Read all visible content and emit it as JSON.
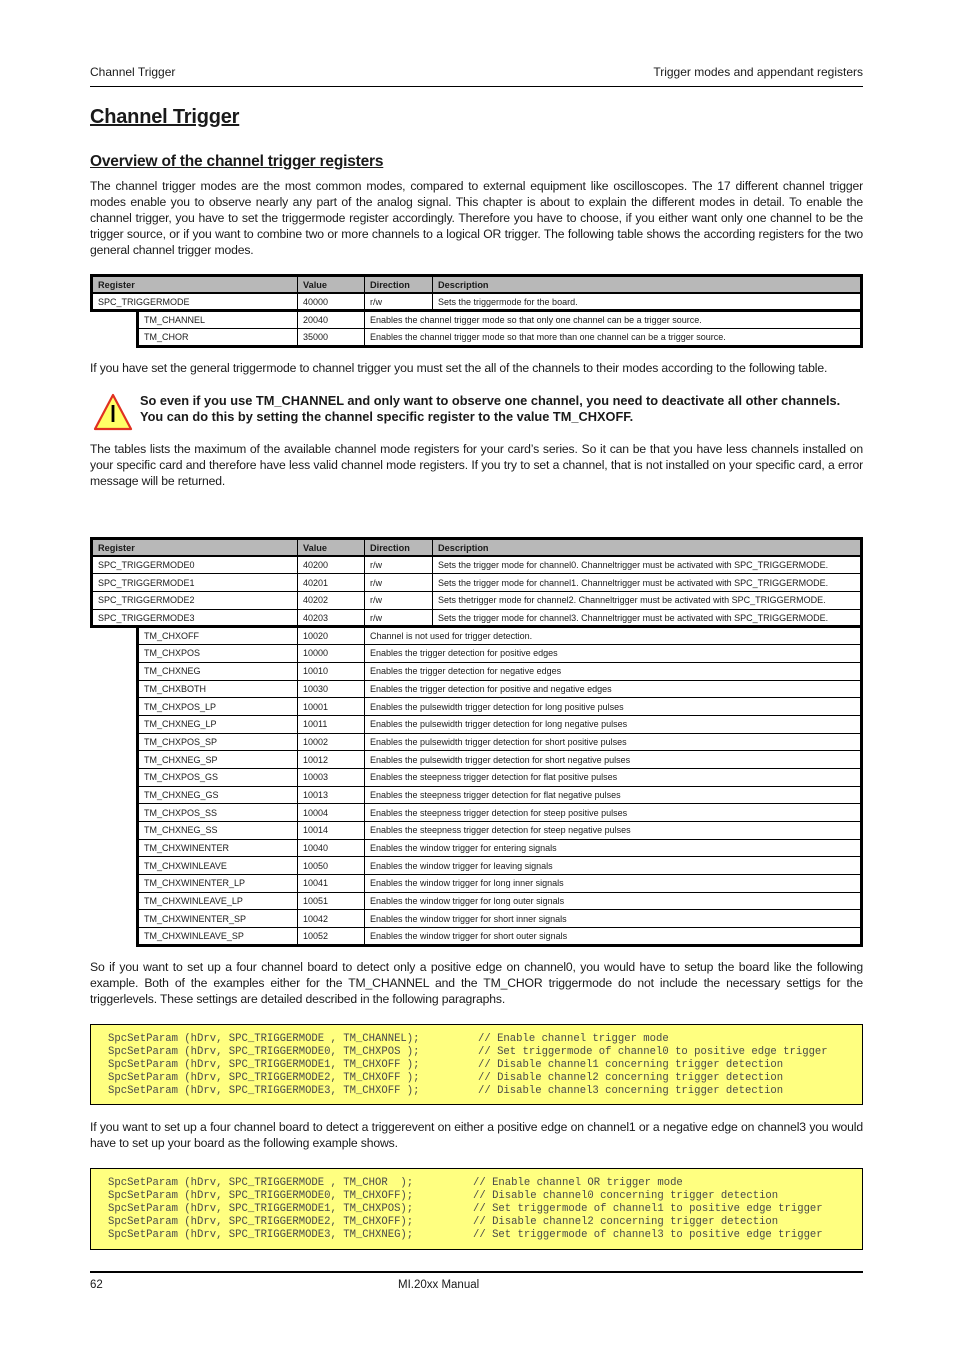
{
  "header": {
    "left": "Channel Trigger",
    "right": "Trigger modes and appendant registers"
  },
  "title": "Channel Trigger",
  "section_title": "Overview of the channel trigger registers",
  "paragraphs": {
    "intro": "The channel trigger modes are the most common modes, compared to external equipment like oscilloscopes. The 17 different channel trigger modes enable you to observe nearly any part of the analog signal. This chapter is about to explain the different modes in detail. To enable the channel trigger, you have to set the triggermode register accordingly. Therefore you have to choose, if you either want only one channel to be the trigger source, or if you want to combine two or more channels to a logical OR trigger. The following table shows the according registers for the two general channel trigger modes.",
    "set_channels": "If you have set the general triggermode to channel trigger you must set the all of the channels to their modes according to the following table.",
    "max_registers": "The tables lists the maximum of the available channel mode registers for your card’s series. So it can be that you have less channels installed on your specific card and therefore have less valid channel mode registers. If you try to set a channel, that is not installed on your specific card, a error message will be returned.",
    "example1_intro": "So if you want to set up a four channel board to detect only a positive edge on channel0, you would have to setup the board like the following example. Both of the examples either for the TM_CHANNEL and the TM_CHOR triggermode do not include the necessary settigs for the triggerlevels. These settings are detailed described in the following paragraphs.",
    "example2_intro": "If you want to set up a four channel board to detect a triggerevent on either a positive edge on channel1 or a negative edge on channel3 you would have to set up your board as the following example shows."
  },
  "warning": {
    "icon": "warning-triangle-icon",
    "text": "So even if you use TM_CHANNEL and only want to observe one channel, you need to deactivate all other channels. You can do this by setting the channel specific register to the value TM_CHXOFF."
  },
  "table1": {
    "headers": [
      "Register",
      "Value",
      "Direction",
      "Description"
    ],
    "main_rows": [
      {
        "register": "SPC_TRIGGERMODE",
        "value": "40000",
        "direction": "r/w",
        "description": "Sets the triggermode for the board."
      }
    ],
    "sub_rows": [
      {
        "register": "TM_CHANNEL",
        "value": "20040",
        "description": "Enables the channel trigger mode so that only one channel can be a trigger source."
      },
      {
        "register": "TM_CHOR",
        "value": "35000",
        "description": "Enables the channel trigger mode so that more than one channel can be a trigger source."
      }
    ]
  },
  "table2": {
    "headers": [
      "Register",
      "Value",
      "Direction",
      "Description"
    ],
    "main_rows": [
      {
        "register": "SPC_TRIGGERMODE0",
        "value": "40200",
        "direction": "r/w",
        "description": "Sets the trigger mode for channel0. Channeltrigger must be activated with SPC_TRIGGERMODE."
      },
      {
        "register": "SPC_TRIGGERMODE1",
        "value": "40201",
        "direction": "r/w",
        "description": "Sets the trigger mode for channel1. Channeltrigger must be activated with SPC_TRIGGERMODE."
      },
      {
        "register": "SPC_TRIGGERMODE2",
        "value": "40202",
        "direction": "r/w",
        "description": "Sets thetrigger mode for channel2. Channeltrigger must be activated with SPC_TRIGGERMODE."
      },
      {
        "register": "SPC_TRIGGERMODE3",
        "value": "40203",
        "direction": "r/w",
        "description": "Sets the trigger mode for channel3. Channeltrigger must be activated with SPC_TRIGGERMODE."
      }
    ],
    "sub_rows": [
      {
        "register": "TM_CHXOFF",
        "value": "10020",
        "description": "Channel is not used for trigger detection."
      },
      {
        "register": "TM_CHXPOS",
        "value": "10000",
        "description": "Enables the trigger detection for positive edges"
      },
      {
        "register": "TM_CHXNEG",
        "value": "10010",
        "description": "Enables the trigger detection for negative edges"
      },
      {
        "register": "TM_CHXBOTH",
        "value": "10030",
        "description": "Enables the trigger detection for positive and negative edges"
      },
      {
        "register": "TM_CHXPOS_LP",
        "value": "10001",
        "description": "Enables the pulsewidth trigger detection for long positive pulses"
      },
      {
        "register": "TM_CHXNEG_LP",
        "value": "10011",
        "description": "Enables the pulsewidth trigger detection for long negative pulses"
      },
      {
        "register": "TM_CHXPOS_SP",
        "value": "10002",
        "description": "Enables the pulsewidth trigger detection for short positive pulses"
      },
      {
        "register": "TM_CHXNEG_SP",
        "value": "10012",
        "description": "Enables the pulsewidth trigger detection for short negative pulses"
      },
      {
        "register": "TM_CHXPOS_GS",
        "value": "10003",
        "description": "Enables the steepness trigger detection for flat positive pulses"
      },
      {
        "register": "TM_CHXNEG_GS",
        "value": "10013",
        "description": "Enables the steepness trigger detection for flat negative pulses"
      },
      {
        "register": "TM_CHXPOS_SS",
        "value": "10004",
        "description": "Enables the steepness trigger detection for steep positive pulses"
      },
      {
        "register": "TM_CHXNEG_SS",
        "value": "10014",
        "description": "Enables the steepness trigger detection for steep negative pulses"
      },
      {
        "register": "TM_CHXWINENTER",
        "value": "10040",
        "description": "Enables the window trigger for entering signals"
      },
      {
        "register": "TM_CHXWINLEAVE",
        "value": "10050",
        "description": "Enables the window trigger for leaving signals"
      },
      {
        "register": "TM_CHXWINENTER_LP",
        "value": "10041",
        "description": "Enables the window trigger for long inner signals"
      },
      {
        "register": "TM_CHXWINLEAVE_LP",
        "value": "10051",
        "description": "Enables the window trigger for long outer signals"
      },
      {
        "register": "TM_CHXWINENTER_SP",
        "value": "10042",
        "description": "Enables the window trigger for short inner signals"
      },
      {
        "register": "TM_CHXWINLEAVE_SP",
        "value": "10052",
        "description": "Enables the window trigger for short outer signals"
      }
    ]
  },
  "code1": [
    {
      "stmt": "SpcSetParam (hDrv, SPC_TRIGGERMODE , TM_CHANNEL);",
      "comment": "// Enable channel trigger mode"
    },
    {
      "stmt": "SpcSetParam (hDrv, SPC_TRIGGERMODE0, TM_CHXPOS );",
      "comment": "// Set triggermode of channel0 to positive edge trigger"
    },
    {
      "stmt": "SpcSetParam (hDrv, SPC_TRIGGERMODE1, TM_CHXOFF );",
      "comment": "// Disable channel1 concerning trigger detection"
    },
    {
      "stmt": "SpcSetParam (hDrv, SPC_TRIGGERMODE2, TM_CHXOFF );",
      "comment": "// Disable channel2 concerning trigger detection"
    },
    {
      "stmt": "SpcSetParam (hDrv, SPC_TRIGGERMODE3, TM_CHXOFF );",
      "comment": "// Disable channel3 concerning trigger detection"
    }
  ],
  "code2": [
    {
      "stmt": "SpcSetParam (hDrv, SPC_TRIGGERMODE , TM_CHOR  );",
      "comment": "// Enable channel OR trigger mode"
    },
    {
      "stmt": "SpcSetParam (hDrv, SPC_TRIGGERMODE0, TM_CHXOFF);",
      "comment": "// Disable channel0 concerning trigger detection"
    },
    {
      "stmt": "SpcSetParam (hDrv, SPC_TRIGGERMODE1, TM_CHXPOS);",
      "comment": "// Set triggermode of channel1 to positive edge trigger"
    },
    {
      "stmt": "SpcSetParam (hDrv, SPC_TRIGGERMODE2, TM_CHXOFF);",
      "comment": "// Disable channel2 concerning trigger detection"
    },
    {
      "stmt": "SpcSetParam (hDrv, SPC_TRIGGERMODE3, TM_CHXNEG);",
      "comment": "// Set triggermode of channel3 to positive edge trigger"
    }
  ],
  "footer": {
    "page_number": "62",
    "manual_title": "MI.20xx Manual"
  }
}
